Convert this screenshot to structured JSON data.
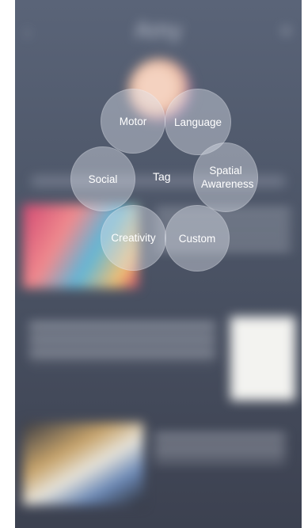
{
  "header": {
    "title": "Amy"
  },
  "menu": {
    "center_label": "Tag",
    "options": [
      {
        "label": "Motor"
      },
      {
        "label": "Language"
      },
      {
        "label": "Social"
      },
      {
        "label": "Spatial Awareness"
      },
      {
        "label": "Creativity"
      },
      {
        "label": "Custom"
      }
    ]
  },
  "colors": {
    "background_top": "#5a6478",
    "background_bottom": "#3c4150",
    "bubble": "#dee2ec"
  }
}
